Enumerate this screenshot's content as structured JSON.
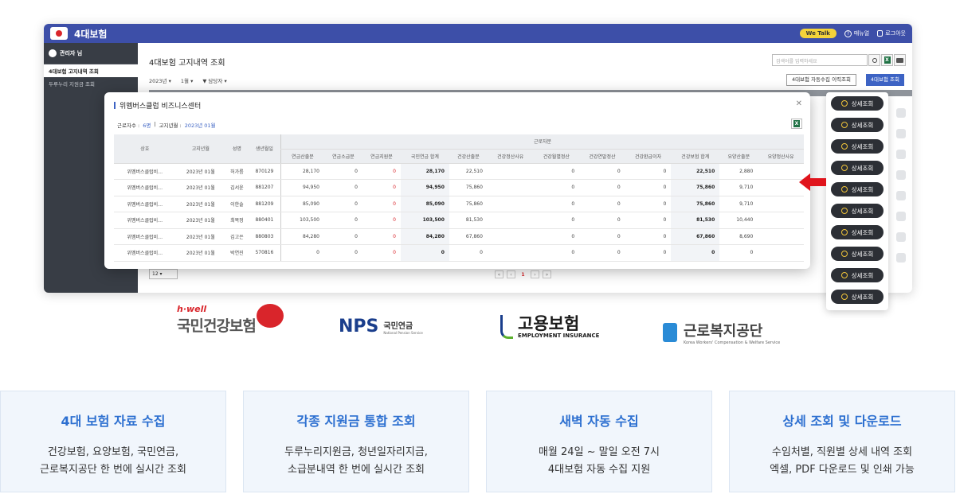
{
  "app": {
    "title": "4대보험",
    "wetalk": "We Talk",
    "manual": "매뉴얼",
    "logout": "로그아웃"
  },
  "sidebar": {
    "admin": "관리자 님",
    "items": [
      "4대보험 고지내역 조회",
      "두루누리 지원금 조회"
    ]
  },
  "main": {
    "page_title": "4대보험 고지내역 조회",
    "search_placeholder": "검색어를 입력하세요",
    "filter_year": "2023년",
    "filter_month": "1월",
    "filter_owner": "담당자",
    "btn_history": "4대보험 자동수집 이력조회",
    "btn_query": "4대보험 조회",
    "page_size": "12",
    "current_page": "1"
  },
  "modal": {
    "title": "위멤버스클럽 비즈니스센터",
    "worker_label": "근로자수 :",
    "worker_count": "6명",
    "notice_label": "고지년월 :",
    "notice_value": "2023년 01월",
    "group_header": "근로자분",
    "columns": [
      "상호",
      "고지년월",
      "성명",
      "생년월일",
      "연금산출분",
      "연금소급분",
      "연금지원분",
      "국민연금 합계",
      "건강산출분",
      "건강정산사유",
      "건강월별정산",
      "건강연말정산",
      "건강환급이자",
      "건강보험 합계",
      "요양산출분",
      "요양정산사유"
    ],
    "rows": [
      [
        "위멤버스클럽비…",
        "2023년 01월",
        "허가름",
        "870129",
        "28,170",
        "0",
        "0",
        "28,170",
        "22,510",
        "",
        "0",
        "0",
        "0",
        "22,510",
        "2,880",
        ""
      ],
      [
        "위멤버스클럽비…",
        "2023년 01월",
        "김서윤",
        "881207",
        "94,950",
        "0",
        "0",
        "94,950",
        "75,860",
        "",
        "0",
        "0",
        "0",
        "75,860",
        "9,710",
        ""
      ],
      [
        "위멤버스클럽비…",
        "2023년 01월",
        "이한솔",
        "881209",
        "85,090",
        "0",
        "0",
        "85,090",
        "75,860",
        "",
        "0",
        "0",
        "0",
        "75,860",
        "9,710",
        ""
      ],
      [
        "위멤버스클럽비…",
        "2023년 01월",
        "최목정",
        "880401",
        "103,500",
        "0",
        "0",
        "103,500",
        "81,530",
        "",
        "0",
        "0",
        "0",
        "81,530",
        "10,440",
        ""
      ],
      [
        "위멤버스클럽비…",
        "2023년 01월",
        "김고은",
        "880803",
        "84,280",
        "0",
        "0",
        "84,280",
        "67,860",
        "",
        "0",
        "0",
        "0",
        "67,860",
        "8,690",
        ""
      ],
      [
        "위멤버스클럽비…",
        "2023년 01월",
        "박연진",
        "570816",
        "0",
        "0",
        "0",
        "0",
        "0",
        "",
        "0",
        "0",
        "0",
        "0",
        "0",
        ""
      ]
    ]
  },
  "detail_buttons": [
    "상세조회",
    "상세조회",
    "상세조회",
    "상세조회",
    "상세조회",
    "상세조회",
    "상세조회",
    "상세조회",
    "상세조회",
    "상세조회"
  ],
  "logos": {
    "nhis_sub": "h·well",
    "nhis": "국민건강보험",
    "nps": "NPS",
    "nps_ko": "국민연금",
    "nps_en": "National Pension Service",
    "ei": "고용보험",
    "ei_en": "EMPLOYMENT INSURANCE",
    "kcomwel": "근로복지공단",
    "kcomwel_en": "Korea Workers' Compensation & Welfare Service"
  },
  "features": [
    {
      "title": "4대 보험 자료 수집",
      "line1": "건강보험, 요양보험, 국민연금,",
      "line2": "근로복지공단 한 번에 실시간 조회"
    },
    {
      "title": "각종 지원금 통합 조회",
      "line1": "두루누리지원금, 청년일자리지금,",
      "line2": "소급분내역 한 번에 실시간 조회"
    },
    {
      "title": "새벽 자동 수집",
      "line1": "매월 24일 ~ 말일 오전 7시",
      "line2": "4대보험 자동 수집 지원"
    },
    {
      "title": "상세 조회 및 다운로드",
      "line1": "수임처별, 직원별 상세 내역 조회",
      "line2": "엑셀, PDF 다운로드 및 인쇄 가능"
    }
  ],
  "colors": {
    "accent": "#3d63c4",
    "topbar": "#3d4fa8",
    "sidebar": "#383d45",
    "highlight": "#d9252b"
  }
}
